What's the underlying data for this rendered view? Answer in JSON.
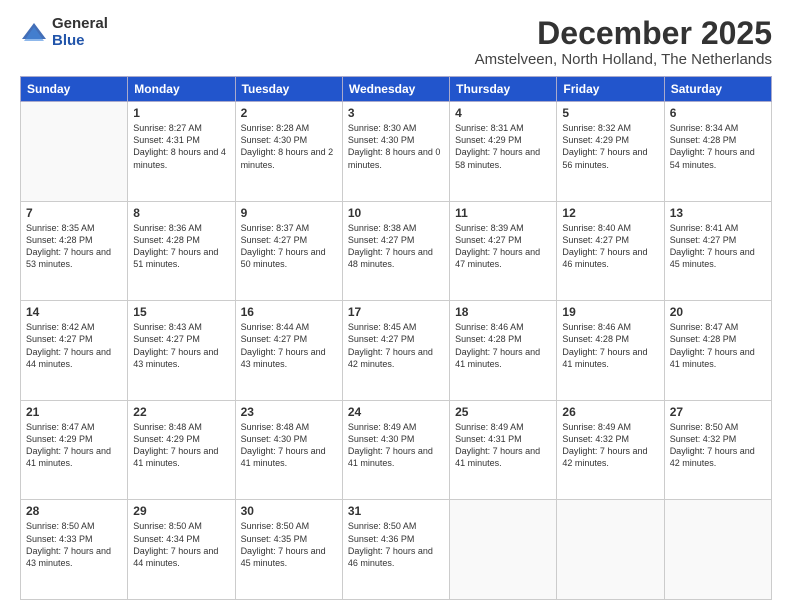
{
  "logo": {
    "general": "General",
    "blue": "Blue"
  },
  "title": "December 2025",
  "subtitle": "Amstelveen, North Holland, The Netherlands",
  "headers": [
    "Sunday",
    "Monday",
    "Tuesday",
    "Wednesday",
    "Thursday",
    "Friday",
    "Saturday"
  ],
  "weeks": [
    [
      {
        "day": "",
        "sunrise": "",
        "sunset": "",
        "daylight": ""
      },
      {
        "day": "1",
        "sunrise": "Sunrise: 8:27 AM",
        "sunset": "Sunset: 4:31 PM",
        "daylight": "Daylight: 8 hours and 4 minutes."
      },
      {
        "day": "2",
        "sunrise": "Sunrise: 8:28 AM",
        "sunset": "Sunset: 4:30 PM",
        "daylight": "Daylight: 8 hours and 2 minutes."
      },
      {
        "day": "3",
        "sunrise": "Sunrise: 8:30 AM",
        "sunset": "Sunset: 4:30 PM",
        "daylight": "Daylight: 8 hours and 0 minutes."
      },
      {
        "day": "4",
        "sunrise": "Sunrise: 8:31 AM",
        "sunset": "Sunset: 4:29 PM",
        "daylight": "Daylight: 7 hours and 58 minutes."
      },
      {
        "day": "5",
        "sunrise": "Sunrise: 8:32 AM",
        "sunset": "Sunset: 4:29 PM",
        "daylight": "Daylight: 7 hours and 56 minutes."
      },
      {
        "day": "6",
        "sunrise": "Sunrise: 8:34 AM",
        "sunset": "Sunset: 4:28 PM",
        "daylight": "Daylight: 7 hours and 54 minutes."
      }
    ],
    [
      {
        "day": "7",
        "sunrise": "Sunrise: 8:35 AM",
        "sunset": "Sunset: 4:28 PM",
        "daylight": "Daylight: 7 hours and 53 minutes."
      },
      {
        "day": "8",
        "sunrise": "Sunrise: 8:36 AM",
        "sunset": "Sunset: 4:28 PM",
        "daylight": "Daylight: 7 hours and 51 minutes."
      },
      {
        "day": "9",
        "sunrise": "Sunrise: 8:37 AM",
        "sunset": "Sunset: 4:27 PM",
        "daylight": "Daylight: 7 hours and 50 minutes."
      },
      {
        "day": "10",
        "sunrise": "Sunrise: 8:38 AM",
        "sunset": "Sunset: 4:27 PM",
        "daylight": "Daylight: 7 hours and 48 minutes."
      },
      {
        "day": "11",
        "sunrise": "Sunrise: 8:39 AM",
        "sunset": "Sunset: 4:27 PM",
        "daylight": "Daylight: 7 hours and 47 minutes."
      },
      {
        "day": "12",
        "sunrise": "Sunrise: 8:40 AM",
        "sunset": "Sunset: 4:27 PM",
        "daylight": "Daylight: 7 hours and 46 minutes."
      },
      {
        "day": "13",
        "sunrise": "Sunrise: 8:41 AM",
        "sunset": "Sunset: 4:27 PM",
        "daylight": "Daylight: 7 hours and 45 minutes."
      }
    ],
    [
      {
        "day": "14",
        "sunrise": "Sunrise: 8:42 AM",
        "sunset": "Sunset: 4:27 PM",
        "daylight": "Daylight: 7 hours and 44 minutes."
      },
      {
        "day": "15",
        "sunrise": "Sunrise: 8:43 AM",
        "sunset": "Sunset: 4:27 PM",
        "daylight": "Daylight: 7 hours and 43 minutes."
      },
      {
        "day": "16",
        "sunrise": "Sunrise: 8:44 AM",
        "sunset": "Sunset: 4:27 PM",
        "daylight": "Daylight: 7 hours and 43 minutes."
      },
      {
        "day": "17",
        "sunrise": "Sunrise: 8:45 AM",
        "sunset": "Sunset: 4:27 PM",
        "daylight": "Daylight: 7 hours and 42 minutes."
      },
      {
        "day": "18",
        "sunrise": "Sunrise: 8:46 AM",
        "sunset": "Sunset: 4:28 PM",
        "daylight": "Daylight: 7 hours and 41 minutes."
      },
      {
        "day": "19",
        "sunrise": "Sunrise: 8:46 AM",
        "sunset": "Sunset: 4:28 PM",
        "daylight": "Daylight: 7 hours and 41 minutes."
      },
      {
        "day": "20",
        "sunrise": "Sunrise: 8:47 AM",
        "sunset": "Sunset: 4:28 PM",
        "daylight": "Daylight: 7 hours and 41 minutes."
      }
    ],
    [
      {
        "day": "21",
        "sunrise": "Sunrise: 8:47 AM",
        "sunset": "Sunset: 4:29 PM",
        "daylight": "Daylight: 7 hours and 41 minutes."
      },
      {
        "day": "22",
        "sunrise": "Sunrise: 8:48 AM",
        "sunset": "Sunset: 4:29 PM",
        "daylight": "Daylight: 7 hours and 41 minutes."
      },
      {
        "day": "23",
        "sunrise": "Sunrise: 8:48 AM",
        "sunset": "Sunset: 4:30 PM",
        "daylight": "Daylight: 7 hours and 41 minutes."
      },
      {
        "day": "24",
        "sunrise": "Sunrise: 8:49 AM",
        "sunset": "Sunset: 4:30 PM",
        "daylight": "Daylight: 7 hours and 41 minutes."
      },
      {
        "day": "25",
        "sunrise": "Sunrise: 8:49 AM",
        "sunset": "Sunset: 4:31 PM",
        "daylight": "Daylight: 7 hours and 41 minutes."
      },
      {
        "day": "26",
        "sunrise": "Sunrise: 8:49 AM",
        "sunset": "Sunset: 4:32 PM",
        "daylight": "Daylight: 7 hours and 42 minutes."
      },
      {
        "day": "27",
        "sunrise": "Sunrise: 8:50 AM",
        "sunset": "Sunset: 4:32 PM",
        "daylight": "Daylight: 7 hours and 42 minutes."
      }
    ],
    [
      {
        "day": "28",
        "sunrise": "Sunrise: 8:50 AM",
        "sunset": "Sunset: 4:33 PM",
        "daylight": "Daylight: 7 hours and 43 minutes."
      },
      {
        "day": "29",
        "sunrise": "Sunrise: 8:50 AM",
        "sunset": "Sunset: 4:34 PM",
        "daylight": "Daylight: 7 hours and 44 minutes."
      },
      {
        "day": "30",
        "sunrise": "Sunrise: 8:50 AM",
        "sunset": "Sunset: 4:35 PM",
        "daylight": "Daylight: 7 hours and 45 minutes."
      },
      {
        "day": "31",
        "sunrise": "Sunrise: 8:50 AM",
        "sunset": "Sunset: 4:36 PM",
        "daylight": "Daylight: 7 hours and 46 minutes."
      },
      {
        "day": "",
        "sunrise": "",
        "sunset": "",
        "daylight": ""
      },
      {
        "day": "",
        "sunrise": "",
        "sunset": "",
        "daylight": ""
      },
      {
        "day": "",
        "sunrise": "",
        "sunset": "",
        "daylight": ""
      }
    ]
  ]
}
